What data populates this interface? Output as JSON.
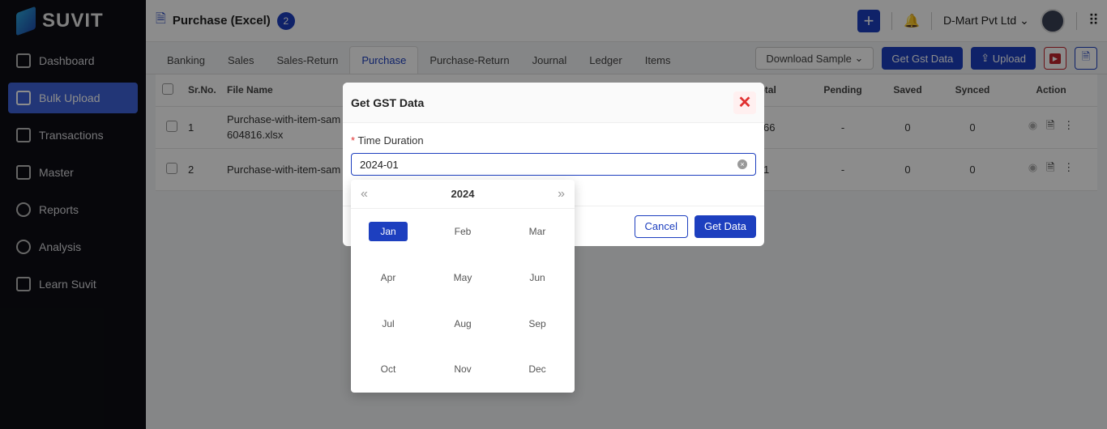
{
  "brand": "SUVIT",
  "sidebar": {
    "items": [
      {
        "label": "Dashboard"
      },
      {
        "label": "Bulk Upload",
        "active": true
      },
      {
        "label": "Transactions"
      },
      {
        "label": "Master"
      },
      {
        "label": "Reports"
      },
      {
        "label": "Analysis"
      },
      {
        "label": "Learn Suvit"
      }
    ]
  },
  "header": {
    "title": "Purchase (Excel)",
    "badge": "2",
    "company": "D-Mart Pvt Ltd"
  },
  "tabs": [
    "Banking",
    "Sales",
    "Sales-Return",
    "Purchase",
    "Purchase-Return",
    "Journal",
    "Ledger",
    "Items"
  ],
  "active_tab": "Purchase",
  "toolbar": {
    "download": "Download Sample",
    "get_gst": "Get Gst Data",
    "upload": "Upload"
  },
  "table": {
    "headers": [
      "Sr.No.",
      "File Name",
      "Total",
      "Pending",
      "Saved",
      "Synced",
      "Action"
    ],
    "rows": [
      {
        "sr": "1",
        "file": "Purchase-with-item-sam",
        "file2": "604816.xlsx",
        "total": "66",
        "pending": "-",
        "saved": "0",
        "synced": "0"
      },
      {
        "sr": "2",
        "file": "Purchase-with-item-sam",
        "total": "1",
        "pending": "-",
        "saved": "0",
        "synced": "0"
      }
    ]
  },
  "modal": {
    "title": "Get GST Data",
    "field_label": "Time Duration",
    "required_mark": "*",
    "value": "2024-01",
    "cancel": "Cancel",
    "submit": "Get Data"
  },
  "picker": {
    "year": "2024",
    "prev": "«",
    "next": "»",
    "months": [
      "Jan",
      "Feb",
      "Mar",
      "Apr",
      "May",
      "Jun",
      "Jul",
      "Aug",
      "Sep",
      "Oct",
      "Nov",
      "Dec"
    ],
    "selected": "Jan"
  },
  "colors": {
    "primary": "#1d3fbf",
    "sidebar": "#0d0e14"
  }
}
